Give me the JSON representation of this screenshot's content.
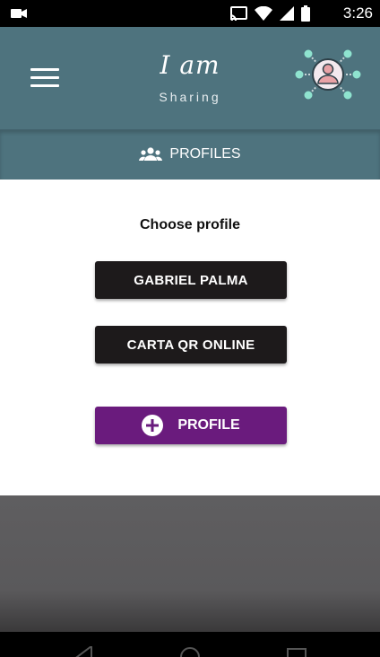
{
  "status_bar": {
    "time": "3:26",
    "icons": [
      "video-camera-icon",
      "cast-icon",
      "wifi-icon",
      "signal-icon",
      "battery-icon"
    ]
  },
  "header": {
    "logo_title": "I am",
    "logo_subtitle": "Sharing",
    "menu_icon": "hamburger-menu-icon",
    "profile_icon": "profile-network-icon"
  },
  "tab": {
    "label": "PROFILES",
    "icon": "group-icon"
  },
  "main": {
    "heading": "Choose profile",
    "profiles": [
      {
        "label": "GABRIEL PALMA"
      },
      {
        "label": "CARTA QR ONLINE"
      }
    ],
    "add_button_label": "PROFILE",
    "add_icon": "plus-circle-icon"
  },
  "colors": {
    "header_bg": "#4e737e",
    "profile_button_bg": "#1d1a1b",
    "add_button_bg": "#6a1b7d",
    "network_node": "#8fe3cf"
  }
}
